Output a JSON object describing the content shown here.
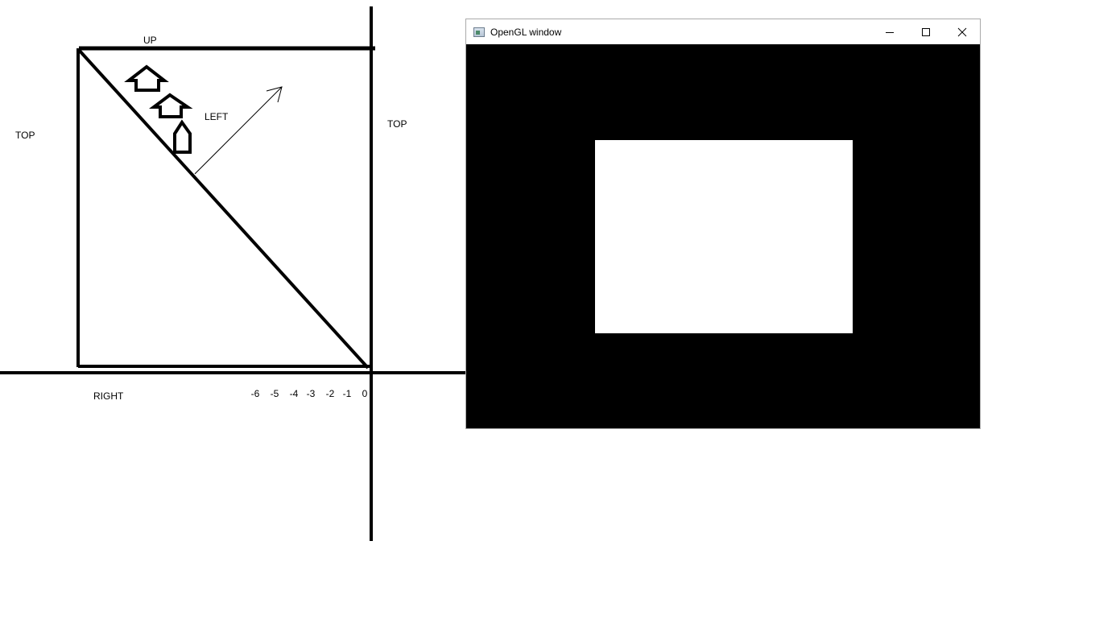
{
  "sketch": {
    "labels": {
      "top_left": "TOP",
      "up": "UP",
      "left": "LEFT",
      "top_right": "TOP",
      "right": "RIGHT"
    },
    "ticks": [
      "-6",
      "-5",
      "-4",
      "-3",
      "-2",
      "-1",
      "0"
    ]
  },
  "window": {
    "title": "OpenGL window",
    "icon": "opengl-app-icon",
    "controls": [
      "minimize-icon",
      "maximize-icon",
      "close-icon"
    ],
    "client_color": "#000000",
    "quad_color": "#ffffff"
  }
}
